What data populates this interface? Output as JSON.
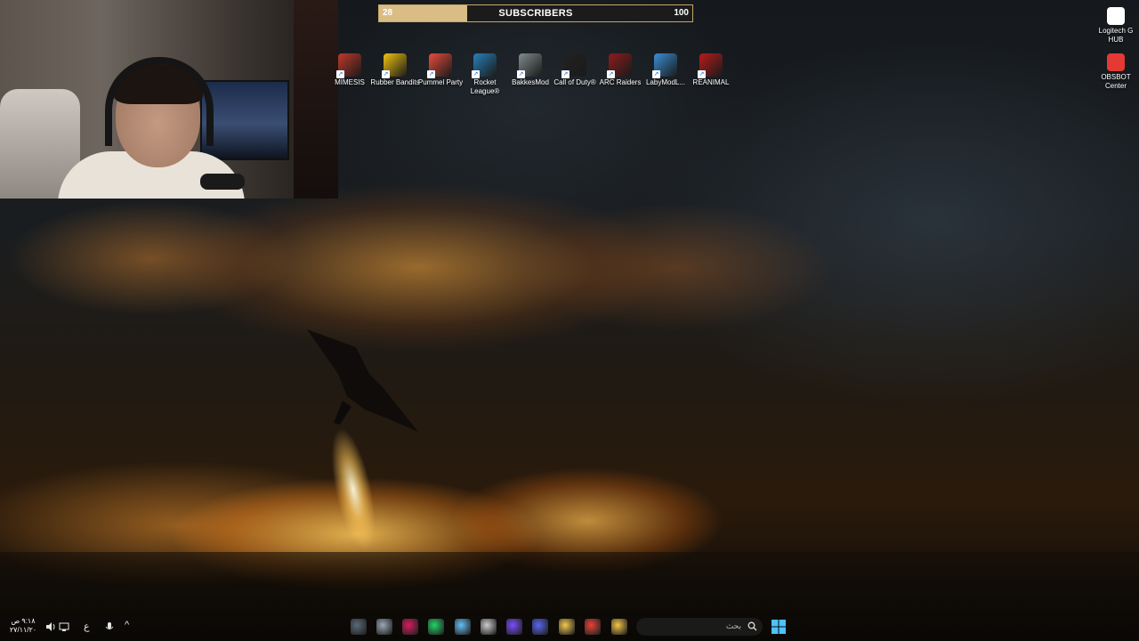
{
  "subscriber_goal": {
    "current": "28",
    "label": "SUBSCRIBERS",
    "target": "100",
    "progress_fraction": 0.28,
    "fill_color": "#d9bd84"
  },
  "desktop_icons": [
    {
      "name": "mimesis",
      "label": "MIMESIS",
      "icon": "mimesis-icon",
      "color": "#c0392b"
    },
    {
      "name": "rubber-bandits",
      "label": "Rubber Bandits",
      "icon": "rubber-bandits-icon",
      "color": "#f1c40f"
    },
    {
      "name": "pummel-party",
      "label": "Pummel Party",
      "icon": "pummel-party-icon",
      "color": "#e74c3c"
    },
    {
      "name": "rocket-league",
      "label": "Rocket League®",
      "icon": "rocket-league-icon",
      "color": "#2980b9"
    },
    {
      "name": "bakkesmod",
      "label": "BakkesMod",
      "icon": "bakkesmod-icon",
      "color": "#7f8c8d"
    },
    {
      "name": "call-of-duty",
      "label": "Call of Duty®",
      "icon": "call-of-duty-icon",
      "color": "#222222"
    },
    {
      "name": "arc-raiders",
      "label": "ARC Raiders",
      "icon": "arc-raiders-icon",
      "color": "#8e1c1c"
    },
    {
      "name": "labymod",
      "label": "LabyModL...",
      "icon": "labymod-icon",
      "color": "#3b8fd6"
    },
    {
      "name": "reanimal",
      "label": "REANIMAL",
      "icon": "reanimal-icon",
      "color": "#b71c1c"
    }
  ],
  "right_icons": [
    {
      "name": "logitech-g-hub",
      "label": "Logitech G HUB",
      "icon": "logitech-g-hub-icon",
      "color": "#ffffff"
    },
    {
      "name": "obsbot-center",
      "label": "OBSBOT Center",
      "icon": "obsbot-center-icon",
      "color": "#e53935"
    }
  ],
  "taskbar": {
    "apps": [
      {
        "name": "snipping-tool",
        "icon": "snipping-tool-icon",
        "color": "#5a6b7b"
      },
      {
        "name": "settings",
        "icon": "gear-icon",
        "color": "#9aa8b6"
      },
      {
        "name": "affinity",
        "icon": "affinity-icon",
        "color": "#d81b60"
      },
      {
        "name": "whatsapp",
        "icon": "whatsapp-icon",
        "color": "#25d366"
      },
      {
        "name": "steam",
        "icon": "steam-icon",
        "color": "#66c0f4"
      },
      {
        "name": "unity",
        "icon": "unity-icon",
        "color": "#cccccc"
      },
      {
        "name": "sp-app",
        "icon": "sp-app-icon",
        "color": "#7c4dff"
      },
      {
        "name": "discord",
        "icon": "discord-icon",
        "color": "#5865f2"
      },
      {
        "name": "microsoft-store",
        "icon": "store-icon",
        "color": "#f2c94c"
      },
      {
        "name": "chrome",
        "icon": "chrome-icon",
        "color": "#ea4335"
      },
      {
        "name": "file-explorer",
        "icon": "folder-icon",
        "color": "#f4c542"
      }
    ],
    "search_placeholder": "بحث",
    "start_icon": "windows-start-icon",
    "clock_time": "٩:١٨ ص",
    "clock_date": "٢٧/١١/٢٠",
    "tray": {
      "language": "ع",
      "chevron": "^"
    }
  }
}
